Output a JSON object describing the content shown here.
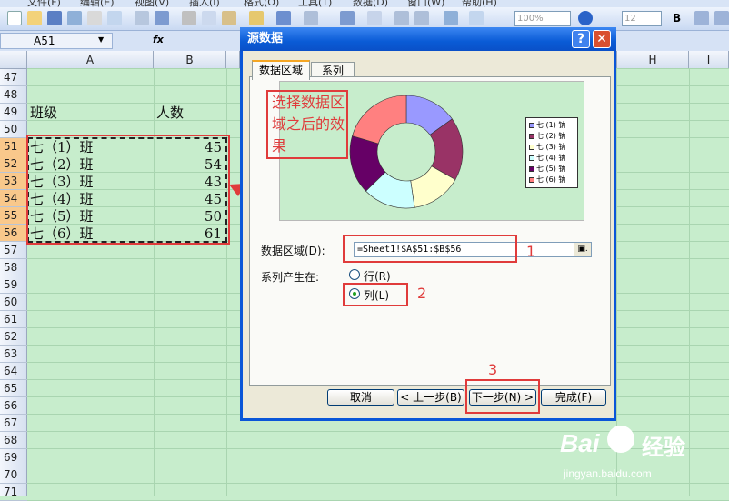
{
  "app": {
    "menu": [
      "文件(F)",
      "编辑(E)",
      "视图(V)",
      "插入(I)",
      "格式(O)",
      "工具(T)",
      "数据(D)",
      "窗口(W)",
      "帮助(H)"
    ],
    "zoom": "100%",
    "font_size": "12",
    "bold_label": "B",
    "name_box": "A51",
    "fx_label": "fx"
  },
  "sheet": {
    "columns": [
      "A",
      "B",
      "H",
      "I"
    ],
    "rows": [
      "47",
      "48",
      "49",
      "50",
      "51",
      "52",
      "53",
      "54",
      "55",
      "56",
      "57",
      "58",
      "59",
      "60",
      "61",
      "62",
      "63",
      "64",
      "65",
      "66",
      "67",
      "68",
      "69",
      "70",
      "71"
    ],
    "header_row": {
      "a": "班级",
      "b": "人数"
    },
    "data": [
      {
        "cls": "七（1）班",
        "num": "45"
      },
      {
        "cls": "七（2）班",
        "num": "54"
      },
      {
        "cls": "七（3）班",
        "num": "43"
      },
      {
        "cls": "七（4）班",
        "num": "45"
      },
      {
        "cls": "七（5）班",
        "num": "50"
      },
      {
        "cls": "七（6）班",
        "num": "61"
      }
    ]
  },
  "dialog": {
    "title": "源数据",
    "help": "?",
    "close": "✕",
    "tabs": [
      "数据区域",
      "系列"
    ],
    "annotation": "选择数据区域之后的效果",
    "legend": [
      "七 (1) 钠",
      "七 (2) 钠",
      "七 (3) 钠",
      "七 (4) 钠",
      "七 (5) 钠",
      "七 (6) 钠"
    ],
    "slice_colors": [
      "#9999ff",
      "#993366",
      "#ffffcc",
      "#ccffff",
      "#660066",
      "#ff8080"
    ],
    "range_label": "数据区域(D):",
    "range_value": "=Sheet1!$A$51:$B$56",
    "range_btn": "▣.",
    "series_label": "系列产生在:",
    "radio_row": "行(R)",
    "radio_col": "列(L)",
    "step_numbers": [
      "1",
      "2",
      "3"
    ],
    "buttons": [
      "取消",
      "< 上一步(B)",
      "下一步(N) >",
      "完成(F)"
    ]
  },
  "watermark": {
    "brand": "Bai",
    "brand2": "经验",
    "url": "jingyan.baidu.com"
  }
}
